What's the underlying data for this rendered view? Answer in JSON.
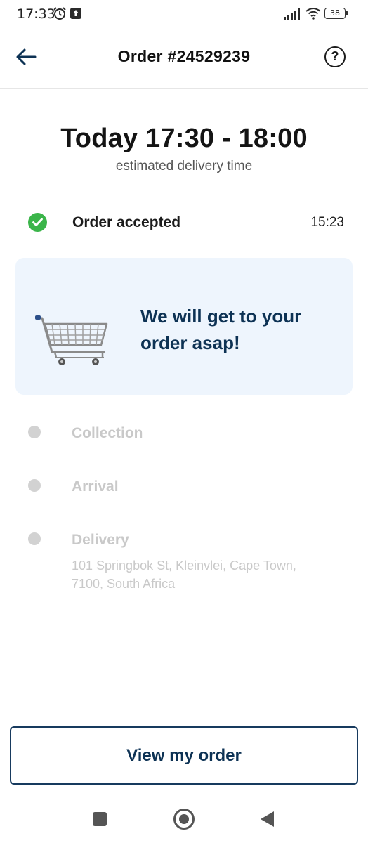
{
  "status_bar": {
    "time": "17:33",
    "battery": "38",
    "icons": [
      "alarm-icon",
      "upload-icon",
      "signal-icon",
      "wifi-icon",
      "battery-icon"
    ]
  },
  "header": {
    "title": "Order #24529239",
    "back_icon": "arrow-left-icon",
    "help_icon": "question-circle-icon",
    "help_glyph": "?"
  },
  "eta": {
    "time": "Today 17:30 - 18:00",
    "label": "estimated delivery time"
  },
  "steps": {
    "accepted": {
      "label": "Order accepted",
      "time": "15:23",
      "status": "done"
    },
    "collection": {
      "label": "Collection",
      "status": "pending"
    },
    "arrival": {
      "label": "Arrival",
      "status": "pending"
    },
    "delivery": {
      "label": "Delivery",
      "address": "101 Springbok St, Kleinvlei, Cape Town, 7100, South Africa",
      "status": "pending"
    }
  },
  "info_card": {
    "icon": "shopping-cart-icon",
    "message": "We will get to your order asap!"
  },
  "actions": {
    "view_order": "View my order"
  },
  "colors": {
    "accent_navy": "#0d3254",
    "success_green": "#3bb54a",
    "card_background": "#eef5fd",
    "pending_grey": "#c9c9c9"
  }
}
